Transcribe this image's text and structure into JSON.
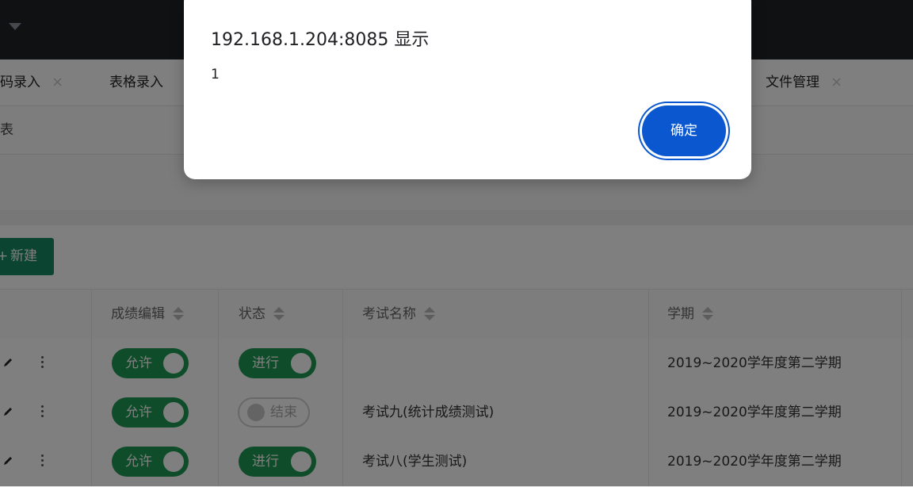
{
  "tabs": [
    {
      "label": "码录入",
      "close": "×"
    },
    {
      "label": "表格录入"
    },
    {
      "label": "文件管理",
      "close": "×"
    }
  ],
  "breadcrumb": "表",
  "toolbar": {
    "new_plus": "+",
    "new_label": "新建"
  },
  "table": {
    "headers": {
      "grade_edit": "成绩编辑",
      "status": "状态",
      "exam_name": "考试名称",
      "term": "学期"
    },
    "rows": [
      {
        "grade_edit": "允许",
        "status": "进行",
        "status_on": true,
        "exam_name": "",
        "term": "2019~2020学年度第二学期"
      },
      {
        "grade_edit": "允许",
        "status": "结束",
        "status_on": false,
        "exam_name": "考试九(统计成绩测试)",
        "term": "2019~2020学年度第二学期"
      },
      {
        "grade_edit": "允许",
        "status": "进行",
        "status_on": true,
        "exam_name": "考试八(学生测试)",
        "term": "2019~2020学年度第二学期"
      }
    ]
  },
  "dialog": {
    "title": "192.168.1.204:8085 显示",
    "message": "1",
    "ok_label": "确定"
  },
  "colors": {
    "topbar": "#1f2327",
    "accent_green": "#1f9a55",
    "new_button": "#168a64",
    "dialog_button": "#0b57d0"
  },
  "icons": {
    "edit": "pencil-icon",
    "more": "more-vertical-icon",
    "sort": "sort-icon",
    "menu": "caret-down-icon"
  }
}
